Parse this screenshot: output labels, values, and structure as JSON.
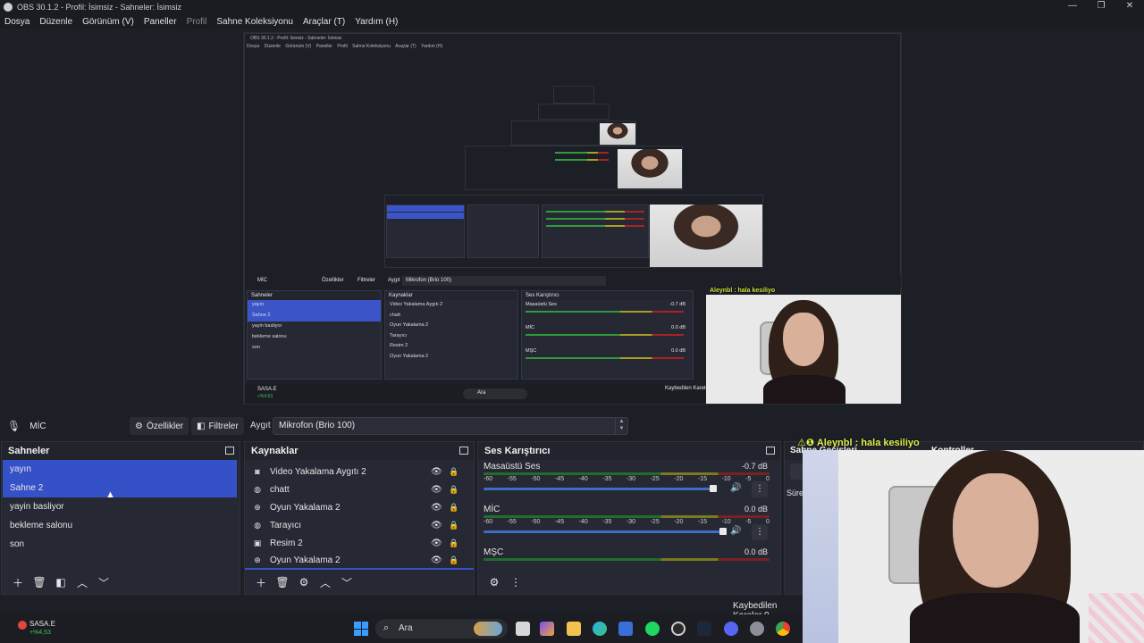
{
  "window": {
    "title": "OBS 30.1.2 - Profil: İsimsiz - Sahneler: İsimsiz",
    "controls": [
      "—",
      "❐",
      "✕"
    ]
  },
  "menu": {
    "file": "Dosya",
    "edit": "Düzenle",
    "view": "Görünüm (V)",
    "docks": "Paneller",
    "profile": "Profil",
    "scene_collection": "Sahne Koleksiyonu",
    "tools": "Araçlar (T)",
    "help": "Yardım (H)"
  },
  "nested_preview": {
    "title": "OBS 30.1.2 - Profil: İsimsiz - Sahneler: İsimsiz",
    "menu": [
      "Dosya",
      "Düzenle",
      "Görünüm (V)",
      "Paneller",
      "Profil",
      "Sahne Koleksiyonu",
      "Araçlar (T)",
      "Yardım (H)"
    ],
    "source_name": "MİC",
    "properties": "Özellikler",
    "filters": "Filtreler",
    "device_label": "Aygıt",
    "device_value": "Mikrofon (Brio 100)",
    "scenes_title": "Sahneler",
    "scenes": [
      "yayın",
      "Sahne 2",
      "yayin basliyor",
      "bekleme salonu",
      "son"
    ],
    "sources_title": "Kaynaklar",
    "sources": [
      "Video Yakalama Aygıtı 2",
      "chatt",
      "Oyun Yakalama 2",
      "Tarayıcı",
      "Resim 2",
      "Oyun Yakalama 2"
    ],
    "mixer_title": "Ses Karıştırıcı",
    "mixer": [
      {
        "name": "Masaüstü Ses",
        "db": "-0.7 dB"
      },
      {
        "name": "MİC",
        "db": "0.0 dB"
      },
      {
        "name": "MŞC",
        "db": "0.0 dB"
      }
    ],
    "cam_caption": "Aleynbl : hala kesiliyo",
    "dropped_frames": "Kaybedilen Kareler",
    "ticker_name": "SASA.E",
    "ticker_change": "+%4,53",
    "search": "Ara"
  },
  "source_toolbar": {
    "source_name": "MİC",
    "properties": "Özellikler",
    "filters": "Filtreler",
    "device_label": "Aygıt",
    "device_value": "Mikrofon (Brio 100)"
  },
  "scenes": {
    "title": "Sahneler",
    "items": [
      {
        "label": "yayın",
        "selected": true
      },
      {
        "label": "Sahne 2",
        "selected": true
      },
      {
        "label": "yayin basliyor",
        "selected": false
      },
      {
        "label": "bekleme salonu",
        "selected": false
      },
      {
        "label": "son",
        "selected": false
      }
    ],
    "footer": [
      "add",
      "remove",
      "filters",
      "move-up",
      "move-down"
    ]
  },
  "sources": {
    "title": "Kaynaklar",
    "items": [
      {
        "label": "Video Yakalama Aygıtı 2",
        "icon": "camera-icon"
      },
      {
        "label": "chatt",
        "icon": "globe-icon"
      },
      {
        "label": "Oyun Yakalama 2",
        "icon": "gamepad-icon"
      },
      {
        "label": "Tarayıcı",
        "icon": "globe-icon"
      },
      {
        "label": "Resim 2",
        "icon": "image-icon"
      },
      {
        "label": "Oyun Yakalama 2",
        "icon": "gamepad-icon"
      }
    ]
  },
  "mixer": {
    "title": "Ses Karıştırıcı",
    "ticks": [
      "-60",
      "-55",
      "-50",
      "-45",
      "-40",
      "-35",
      "-30",
      "-25",
      "-20",
      "-15",
      "-10",
      "-5",
      "0"
    ],
    "channels": [
      {
        "name": "Masaüstü Ses",
        "db": "-0.7 dB",
        "has_slider": true
      },
      {
        "name": "MİC",
        "db": "0.0 dB",
        "has_slider": true
      },
      {
        "name": "MŞC",
        "db": "0.0 dB",
        "has_slider": false
      }
    ]
  },
  "transitions": {
    "title": "Sahne Geçişleri",
    "duration_label": "Süre"
  },
  "controls": {
    "title": "Kontroller"
  },
  "webcam": {
    "caption": "⚠❶ Aleynbl : hala kesiliyo"
  },
  "status": {
    "dropped_frames": "Kaybedilen Kareler 0"
  },
  "taskbar": {
    "ticker_name": "SASA.E",
    "ticker_change": "+%4,53",
    "search_placeholder": "Ara"
  },
  "colors": {
    "selection": "#3551c8",
    "dock_bg": "#262833",
    "app_bg": "#1d1f26",
    "caption": "#dff04a"
  }
}
